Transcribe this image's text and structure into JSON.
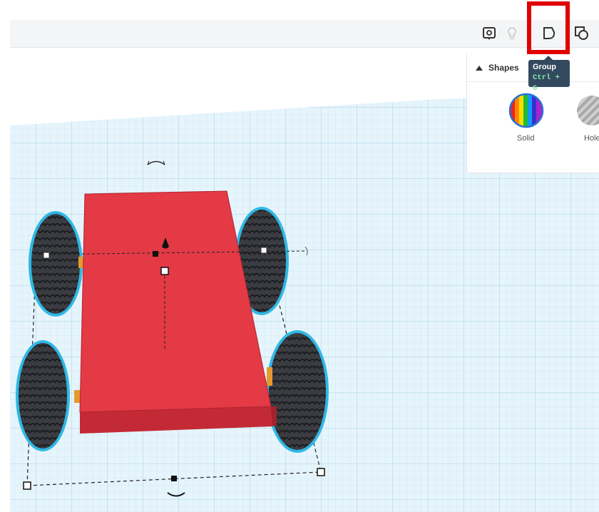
{
  "toolbar": {
    "icons": [
      "notes-icon",
      "light-bulb-icon",
      "group-icon",
      "ungroup-icon"
    ]
  },
  "tooltip": {
    "title": "Group",
    "shortcut": "Ctrl + G"
  },
  "shapes_panel": {
    "title": "Shapes",
    "items": [
      {
        "label": "Solid",
        "icon": "rainbow-solid-icon"
      },
      {
        "label": "Hole",
        "icon": "striped-hole-icon"
      }
    ]
  },
  "colors": {
    "highlight": "#e00000",
    "box": "#e33a46",
    "grid": "#c8e6f5",
    "tire": "#3d3f44",
    "tire_outline": "#2fb8e6",
    "tooltip_bg": "#35495e"
  }
}
